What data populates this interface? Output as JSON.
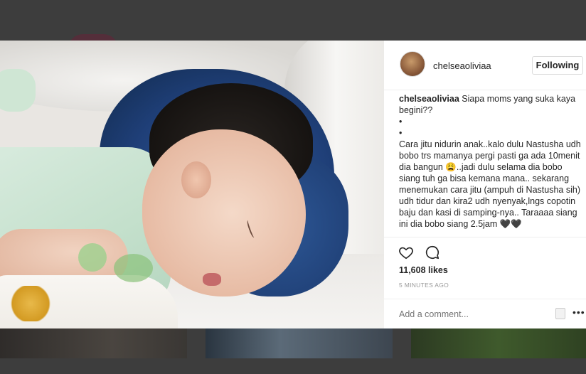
{
  "post": {
    "username": "chelseaoliviaa",
    "follow_label": "Following",
    "caption": {
      "username": "chelseaoliviaa",
      "text_first": "Siapa moms yang suka kaya begini??",
      "lines": [
        "•",
        "•",
        "Cara jitu nidurin anak..kalo dulu Nastusha udh bobo trs mamanya pergi pasti ga ada 10menit dia bangun 😩..jadi dulu selama dia bobo siang tuh ga bisa kemana mana.. sekarang menemukan cara jitu (ampuh di Nastusha sih) udh tidur dan kira2 udh nyenyak,lngs copotin baju dan kasi di samping-nya.. Taraaaa siang ini dia bobo siang 2.5jam 🖤🖤"
      ]
    },
    "likes": "11,608 likes",
    "time": "5 MINUTES AGO",
    "comment_placeholder": "Add a comment...",
    "more_label": "•••"
  },
  "icons": {
    "like": "heart-icon",
    "comment": "comment-icon",
    "more": "more-options-icon"
  },
  "colors": {
    "text": "#262626",
    "muted": "#999999",
    "border": "#efefef",
    "backdrop": "#3d3d3d"
  }
}
